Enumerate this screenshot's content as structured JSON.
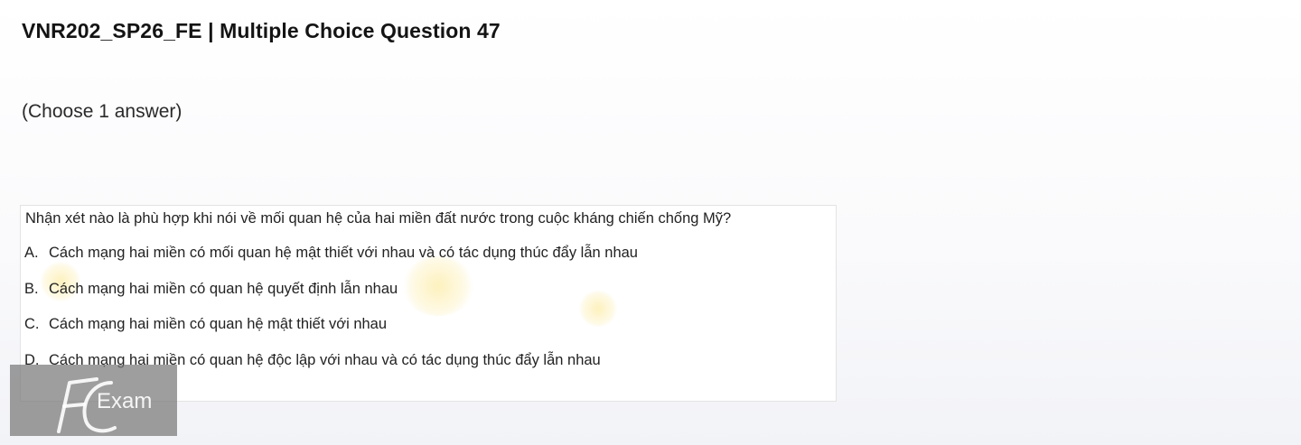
{
  "page": {
    "title": "VNR202_SP26_FE | Multiple Choice Question 47",
    "instruction": "(Choose 1 answer)"
  },
  "question": {
    "stem": "Nhận xét nào là phù hợp khi nói về mối quan hệ của hai miền đất nước trong cuộc kháng chiến chống Mỹ?",
    "options": [
      {
        "letter": "A.",
        "text": "Cách mạng hai miền có mối quan hệ mật thiết với nhau và có tác dụng thúc đẩy lẫn nhau"
      },
      {
        "letter": "B.",
        "text": "Cách mạng hai miền có quan hệ quyết định lẫn nhau"
      },
      {
        "letter": "C.",
        "text": "Cách mạng hai miền có quan hệ mật thiết với nhau"
      },
      {
        "letter": "D.",
        "text": "Cách mạng hai miền có quan hệ độc lập với nhau và có tác dụng thúc đẩy lẫn nhau"
      }
    ]
  },
  "watermark": {
    "logo_text": "FUExam",
    "icon": "fuexam-logo-icon"
  },
  "colors": {
    "title": "#141414",
    "body_text": "#222222",
    "logo_badge": "#787878",
    "watermark_yellow": "#fae06e"
  }
}
